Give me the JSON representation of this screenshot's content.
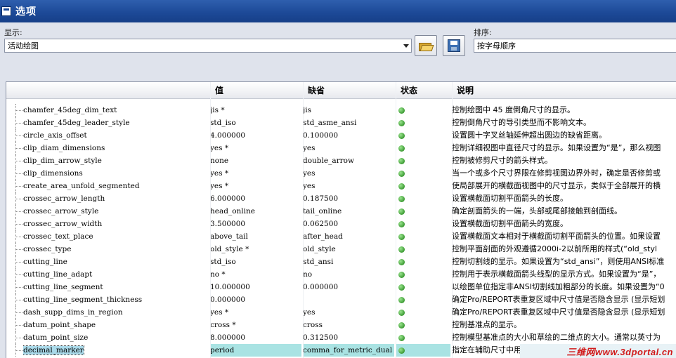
{
  "window": {
    "title": "选项"
  },
  "display": {
    "label": "显示:",
    "selected": "活动绘图"
  },
  "sort": {
    "label": "排序:",
    "selected": "按字母顺序"
  },
  "toolbar": {
    "open_icon": "folder-open-icon",
    "save_icon": "save-icon"
  },
  "table": {
    "columns": [
      "值",
      "缺省",
      "状态",
      "说明"
    ],
    "rows": [
      {
        "name": "chamfer_45deg_dim_text",
        "value": "jis *",
        "default": "jis",
        "desc": "控制绘图中 45 度倒角尺寸的显示。"
      },
      {
        "name": "chamfer_45deg_leader_style",
        "value": "std_iso",
        "default": "std_asme_ansi",
        "desc": "控制倒角尺寸的导引类型而不影响文本。"
      },
      {
        "name": "circle_axis_offset",
        "value": "4.000000",
        "default": "0.100000",
        "desc": "设置圆十字叉丝轴延伸超出圆边的缺省距离。"
      },
      {
        "name": "clip_diam_dimensions",
        "value": "yes *",
        "default": "yes",
        "desc": "控制详细视图中直径尺寸的显示。如果设置为“是”，那么视图"
      },
      {
        "name": "clip_dim_arrow_style",
        "value": "none",
        "default": "double_arrow",
        "desc": "控制被修剪尺寸的箭头样式。"
      },
      {
        "name": "clip_dimensions",
        "value": "yes *",
        "default": "yes",
        "desc": "当一个或多个尺寸界限在修剪视图边界外时，确定是否修剪或"
      },
      {
        "name": "create_area_unfold_segmented",
        "value": "yes *",
        "default": "yes",
        "desc": "使局部展开的横截面视图中的尺寸显示，类似于全部展开的横"
      },
      {
        "name": "crossec_arrow_length",
        "value": "6.000000",
        "default": "0.187500",
        "desc": "设置横截面切割平面箭头的长度。"
      },
      {
        "name": "crossec_arrow_style",
        "value": "head_online",
        "default": "tail_online",
        "desc": "确定剖面箭头的一端，头部或尾部接触到剖面线。"
      },
      {
        "name": "crossec_arrow_width",
        "value": "3.500000",
        "default": "0.062500",
        "desc": "设置横截面切割平面箭头的宽度。"
      },
      {
        "name": "crossec_text_place",
        "value": "above_tail",
        "default": "after_head",
        "desc": "设置横截面文本相对于横截面切割平面箭头的位置。如果设置"
      },
      {
        "name": "crossec_type",
        "value": "old_style *",
        "default": "old_style",
        "desc": "控制平面剖面的外观遵循2000i-2以前所用的样式(“old_styl"
      },
      {
        "name": "cutting_line",
        "value": "std_iso",
        "default": "std_ansi",
        "desc": "控制切割线的显示。如果设置为“std_ansi”，则使用ANSI标准"
      },
      {
        "name": "cutting_line_adapt",
        "value": "no *",
        "default": "no",
        "desc": "控制用于表示横截面箭头线型的显示方式。如果设置为“是”，"
      },
      {
        "name": "cutting_line_segment",
        "value": "10.000000",
        "default": "0.000000",
        "desc": "以绘图单位指定非ANSI切割线加粗部分的长度。如果设置为“0"
      },
      {
        "name": "cutting_line_segment_thickness",
        "value": "0.000000",
        "default": "",
        "desc": "确定Pro/REPORT表重复区域中尺寸值是否隐含显示 (显示短划"
      },
      {
        "name": "dash_supp_dims_in_region",
        "value": "yes *",
        "default": "yes",
        "desc": "确定Pro/REPORT表重复区域中尺寸值是否隐含显示 (显示短划"
      },
      {
        "name": "datum_point_shape",
        "value": "cross *",
        "default": "cross",
        "desc": "控制基准点的显示。"
      },
      {
        "name": "datum_point_size",
        "value": "8.000000",
        "default": "0.312500",
        "desc": "控制模型基准点的大小和草绘的二维点的大小。通常以英寸为"
      },
      {
        "name": "decimal_marker",
        "value": "period",
        "default": "comma_for_metric_dual",
        "desc": "指定在辅助尺寸中用"
      }
    ]
  },
  "colors": {
    "status_ok": "#3d9b34",
    "title_bar": "#1d4a98",
    "selection": "#a9e3e3"
  },
  "watermark": {
    "text": "三维网www.3dportal.cn"
  }
}
